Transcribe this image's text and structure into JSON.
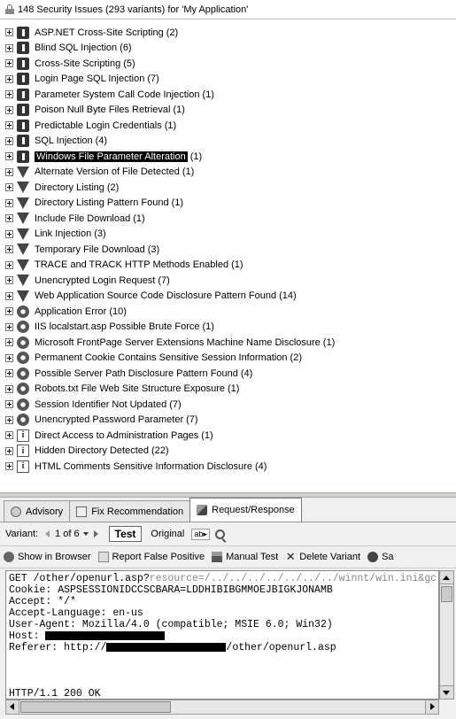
{
  "header": {
    "title": "148 Security Issues (293 variants) for 'My Application'"
  },
  "issues": [
    {
      "label": "ASP.NET Cross-Site Scripting",
      "count": "(2)",
      "severity": "high"
    },
    {
      "label": "Blind SQL Injection",
      "count": "(6)",
      "severity": "high"
    },
    {
      "label": "Cross-Site Scripting",
      "count": "(5)",
      "severity": "high"
    },
    {
      "label": "Login Page SQL Injection",
      "count": "(7)",
      "severity": "high"
    },
    {
      "label": "Parameter System Call Code Injection",
      "count": "(1)",
      "severity": "high"
    },
    {
      "label": "Poison Null Byte Files Retrieval",
      "count": "(1)",
      "severity": "high"
    },
    {
      "label": "Predictable Login Credentials",
      "count": "(1)",
      "severity": "high"
    },
    {
      "label": "SQL Injection",
      "count": "(4)",
      "severity": "high"
    },
    {
      "label": "Windows File Parameter Alteration",
      "count": "(1)",
      "severity": "high",
      "selected": true
    },
    {
      "label": "Alternate Version of File Detected",
      "count": "(1)",
      "severity": "medium"
    },
    {
      "label": "Directory Listing",
      "count": "(2)",
      "severity": "medium"
    },
    {
      "label": "Directory Listing Pattern Found",
      "count": "(1)",
      "severity": "medium"
    },
    {
      "label": "Include File Download",
      "count": "(1)",
      "severity": "medium"
    },
    {
      "label": "Link Injection",
      "count": "(3)",
      "severity": "medium"
    },
    {
      "label": "Temporary File Download",
      "count": "(3)",
      "severity": "medium"
    },
    {
      "label": "TRACE and TRACK HTTP Methods Enabled",
      "count": "(1)",
      "severity": "medium"
    },
    {
      "label": "Unencrypted Login Request",
      "count": "(7)",
      "severity": "medium"
    },
    {
      "label": "Web Application Source Code Disclosure Pattern Found",
      "count": "(14)",
      "severity": "medium"
    },
    {
      "label": "Application Error",
      "count": "(10)",
      "severity": "low"
    },
    {
      "label": "IIS localstart.asp Possible Brute Force",
      "count": "(1)",
      "severity": "low"
    },
    {
      "label": "Microsoft FrontPage Server Extensions Machine Name Disclosure",
      "count": "(1)",
      "severity": "low"
    },
    {
      "label": "Permanent Cookie Contains Sensitive Session Information",
      "count": "(2)",
      "severity": "low"
    },
    {
      "label": "Possible Server Path Disclosure Pattern Found",
      "count": "(4)",
      "severity": "low"
    },
    {
      "label": "Robots.txt File Web Site Structure Exposure",
      "count": "(1)",
      "severity": "low"
    },
    {
      "label": "Session Identifier Not Updated",
      "count": "(7)",
      "severity": "low"
    },
    {
      "label": "Unencrypted Password Parameter",
      "count": "(7)",
      "severity": "low"
    },
    {
      "label": "Direct Access to Administration Pages",
      "count": "(1)",
      "severity": "info"
    },
    {
      "label": "Hidden Directory Detected",
      "count": "(22)",
      "severity": "info"
    },
    {
      "label": "HTML Comments Sensitive Information Disclosure",
      "count": "(4)",
      "severity": "info"
    }
  ],
  "tabs": [
    {
      "label": "Advisory",
      "icon": "advisory-icon"
    },
    {
      "label": "Fix Recommendation",
      "icon": "fix-recommendation-icon"
    },
    {
      "label": "Request/Response",
      "icon": "request-response-icon",
      "active": true
    }
  ],
  "variant": {
    "label": "Variant:",
    "position": "1 of 6",
    "test_label": "Test",
    "original_label": "Original"
  },
  "toolbar": {
    "show_in_browser": "Show in Browser",
    "report_false_positive": "Report False Positive",
    "manual_test": "Manual Test",
    "delete_variant": "Delete Variant",
    "save": "Sa"
  },
  "request": {
    "line1_prefix": "GET /other/openurl.asp?",
    "line1_param": "resource=/../../../../../../../winnt/win.ini&gc",
    "cookie": "Cookie: ASPSESSIONIDCCSCBARA=LDDHIBIBGMMOEJBIGKJONAMB",
    "accept": "Accept: */*",
    "accept_language": "Accept-Language: en-us",
    "user_agent": "User-Agent: Mozilla/4.0 (compatible; MSIE 6.0; Win32)",
    "host_label": "Host: ",
    "referer_prefix": "Referer: http://",
    "referer_suffix": "/other/openurl.asp",
    "response_line": "HTTP/1.1 200 OK"
  }
}
